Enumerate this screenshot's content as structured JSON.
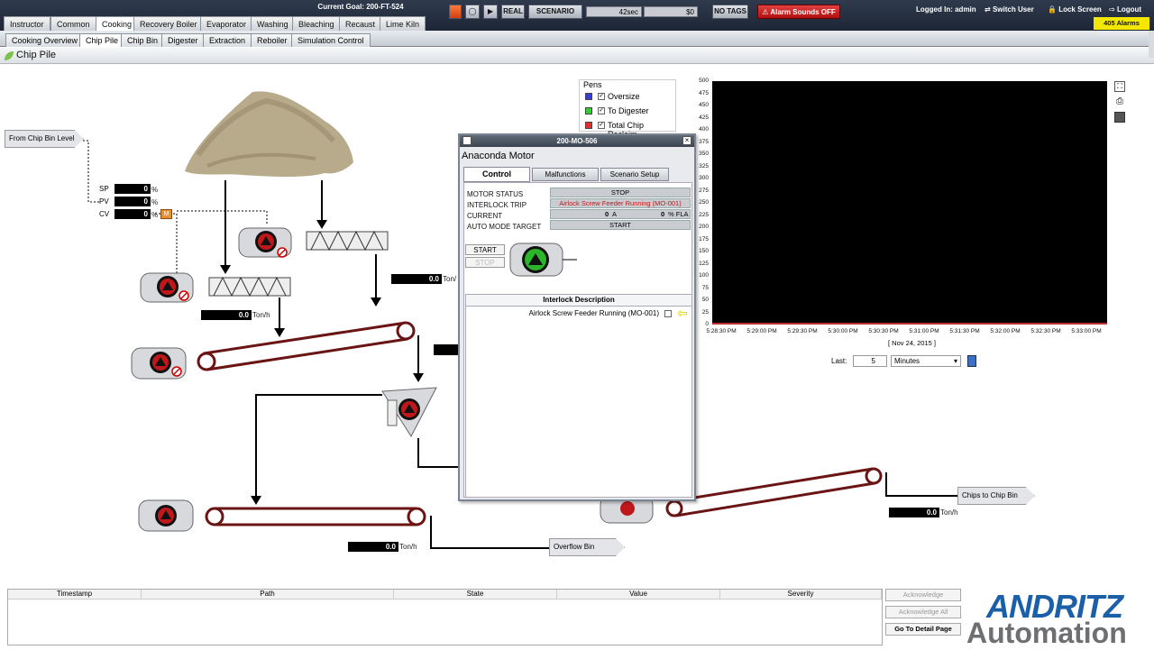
{
  "topbar": {
    "goal": "Current Goal:  200-FT-524",
    "nav_tabs": [
      "Instructor",
      "Common",
      "Cooking",
      "Recovery Boiler",
      "Evaporator",
      "Washing",
      "Bleaching",
      "Recaust",
      "Lime Kiln"
    ],
    "real_label": "REAL",
    "scenario_label": "SCENARIO",
    "speed_value": "42sec",
    "extra_value": "$0",
    "notags_label": "NO TAGS",
    "alarm_sounds_label": "Alarm Sounds OFF",
    "logged_in": "Logged In: admin",
    "switch_user": "Switch User",
    "lock_screen": "Lock Screen",
    "logout": "Logout",
    "alarm_count": "405 Alarms"
  },
  "subtabs": [
    "Cooking Overview",
    "Chip Pile",
    "Chip Bin",
    "Digester",
    "Extraction",
    "Reboiler",
    "Simulation Control"
  ],
  "page_title": "Chip Pile",
  "process": {
    "from_chip_bin_level": "From Chip Bin Level",
    "sp_label": "SP",
    "pv_label": "PV",
    "cv_label": "CV",
    "sp_value": "0",
    "pv_value": "0",
    "cv_value": "0",
    "pct": "%",
    "manual_label": "M",
    "flow1": "0.0",
    "flow2": "0.0",
    "flow3": "0.0",
    "flow4": "0.0",
    "flow_unit": "Ton/h",
    "flow_unit_partial": "Ton/",
    "chips_to_chip_bin": "Chips to Chip Bin",
    "overflow_bin": "Overflow Bin"
  },
  "dialog": {
    "title": "200-MO-506",
    "heading": "Anaconda Motor",
    "tabs": [
      "Control",
      "Malfunctions",
      "Scenario Setup"
    ],
    "fields": {
      "motor_status_label": "MOTOR STATUS",
      "motor_status_value": "STOP",
      "interlock_trip_label": "INTERLOCK TRIP",
      "interlock_trip_value": "Airlock Screw Feeder Running (MO-001)",
      "current_label": "CURRENT",
      "current_value": "0",
      "current_unit": "A",
      "current_fla_value": "0",
      "current_fla_unit": "% FLA",
      "auto_mode_label": "AUTO MODE TARGET",
      "auto_mode_value": "START"
    },
    "start_label": "START",
    "stop_label": "STOP",
    "interlock_header": "Interlock Description",
    "interlock_item": "Airlock Screw Feeder Running (MO-001)"
  },
  "trend": {
    "pens_title": "Pens",
    "pens": [
      {
        "name": "Oversize",
        "color": "#3a3ad8"
      },
      {
        "name": "To Digester",
        "color": "#33cc33"
      },
      {
        "name": "Total Chip Reclaim",
        "color": "#e03030"
      }
    ],
    "y_ticks": [
      "500",
      "475",
      "450",
      "425",
      "400",
      "375",
      "350",
      "325",
      "300",
      "275",
      "250",
      "225",
      "200",
      "175",
      "150",
      "125",
      "100",
      "75",
      "50",
      "25",
      "0"
    ],
    "x_ticks": [
      "5:28:30 PM",
      "5:29:00 PM",
      "5:29:30 PM",
      "5:30:00 PM",
      "5:30:30 PM",
      "5:31:00 PM",
      "5:31:30 PM",
      "5:32:00 PM",
      "5:32:30 PM",
      "5:33:00 PM"
    ],
    "date_label": "[ Nov 24, 2015 ]",
    "last_label": "Last:",
    "last_value": "5",
    "unit_value": "Minutes"
  },
  "alarm_table": {
    "columns": [
      "Timestamp",
      "Path",
      "State",
      "Value",
      "Severity"
    ],
    "acknowledge": "Acknowledge",
    "acknowledge_all": "Acknowledge All",
    "go_to_detail": "Go To Detail Page"
  },
  "logo": {
    "top": "ANDRITZ",
    "bottom": "Automation"
  },
  "colors": {
    "accent": "#f5e800",
    "alarm": "#c81818",
    "conveyor": "#6a1414"
  }
}
